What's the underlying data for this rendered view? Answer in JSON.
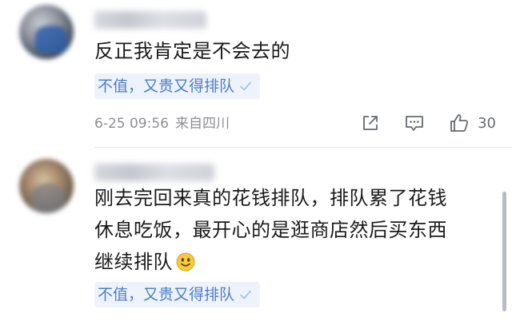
{
  "comments": [
    {
      "body_lines": [
        "反正我肯定是不会去的"
      ],
      "tag": "不值，又贵又得排队",
      "date": "6-25 09:56",
      "location": "来自四川",
      "likes": "30"
    },
    {
      "body_lines": [
        "刚去完回来真的花钱排队，排队累了花钱",
        "休息吃饭，最开心的是逛商店然后买东西",
        "继续排队"
      ],
      "tag": "不值，又贵又得排队"
    }
  ],
  "icons": {
    "share": "share-icon",
    "comment": "comment-icon",
    "like": "thumbs-up-icon",
    "check": "check-icon",
    "emoji": "smiley-emoji-icon"
  },
  "colors": {
    "tag_text": "#4a7ec6",
    "tag_bg": "#eef3fb",
    "meta_text": "#8e8e93"
  }
}
